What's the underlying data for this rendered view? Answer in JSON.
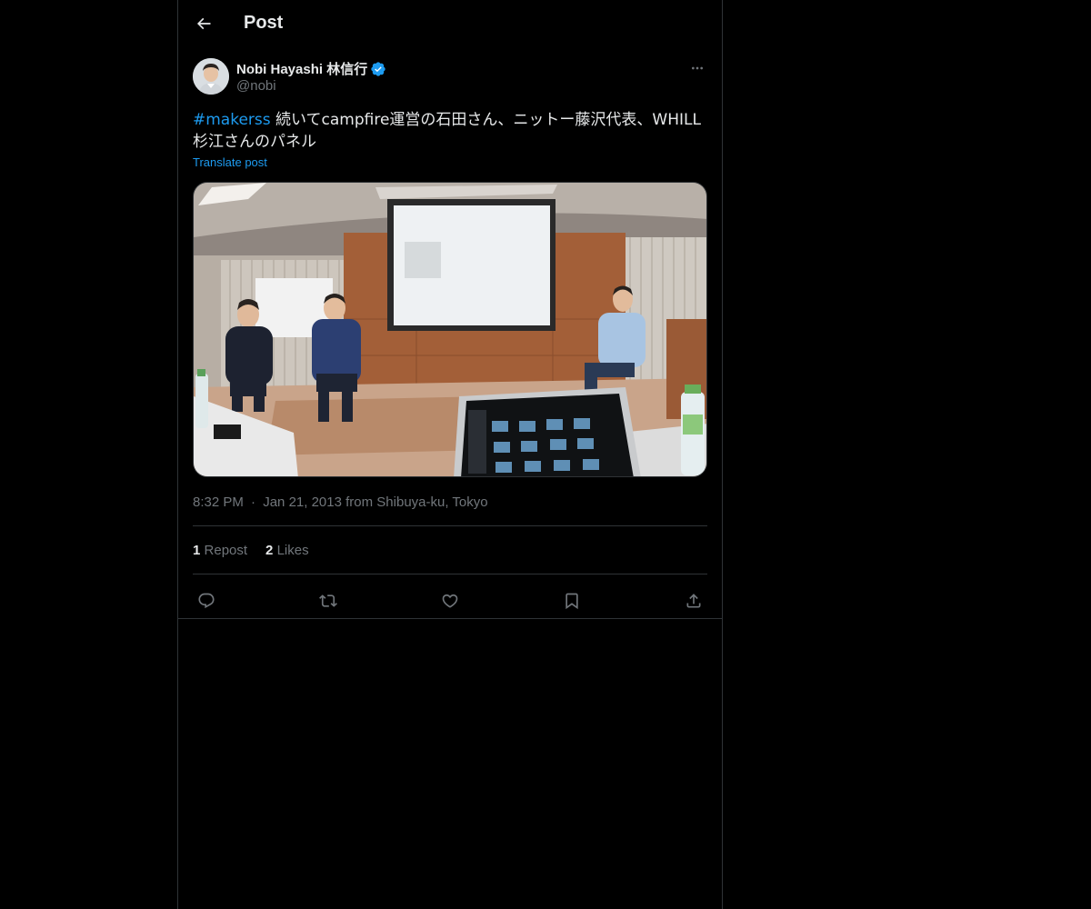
{
  "header": {
    "title": "Post"
  },
  "post": {
    "author": {
      "name": "Nobi Hayashi 林信行",
      "handle": "@nobi",
      "verified": true
    },
    "text": {
      "hashtag": "#makerss",
      "body": " 続いてcampfire運営の石田さん、ニットー藤沢代表、WHILL杉江さんのパネル"
    },
    "translate_label": "Translate post",
    "time": "8:32 PM",
    "separator": "·",
    "date_location": "Jan 21, 2013 from Shibuya-ku, Tokyo",
    "stats": {
      "reposts_count": "1",
      "reposts_label": "Repost",
      "likes_count": "2",
      "likes_label": "Likes"
    }
  },
  "colors": {
    "background": "#000000",
    "text": "#e7e9ea",
    "muted": "#71767b",
    "accent": "#1d9bf0",
    "border": "#2f3336"
  },
  "icons": {
    "back": "arrow-left-icon",
    "verified": "verified-badge-icon",
    "more": "more-horizontal-icon",
    "reply": "reply-icon",
    "repost": "repost-icon",
    "like": "heart-icon",
    "bookmark": "bookmark-icon",
    "share": "share-icon"
  }
}
